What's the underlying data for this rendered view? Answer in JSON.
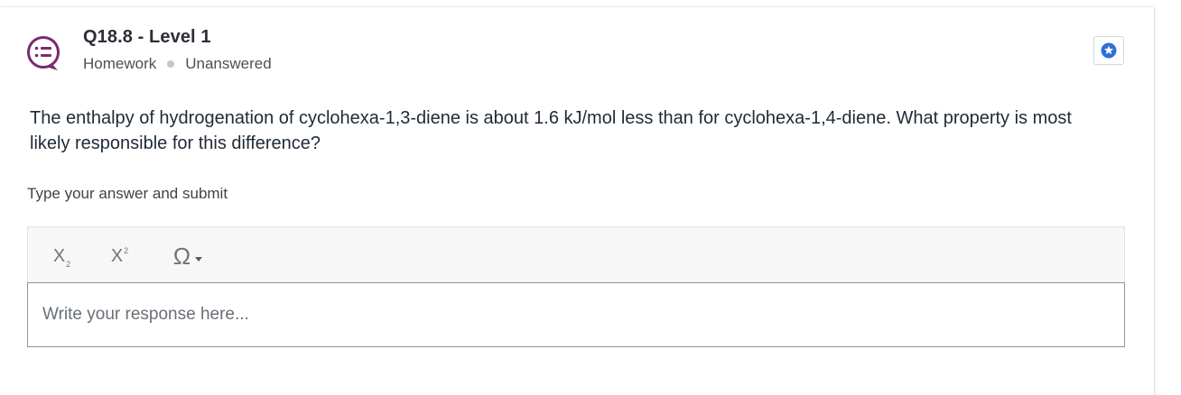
{
  "header": {
    "title": "Q18.8 - Level 1",
    "category": "Homework",
    "status": "Unanswered"
  },
  "icons": {
    "question_icon": "speech-bubble-list-icon",
    "star_icon": "star-badge-icon"
  },
  "colors": {
    "question_icon_accent": "#7a2a6e",
    "star_accent": "#2f6fd6"
  },
  "question": {
    "text": "The enthalpy of hydrogenation of cyclohexa-1,3-diene is about 1.6 kJ/mol less than for cyclohexa-1,4-diene. What property is most likely responsible for this difference?"
  },
  "answer": {
    "prompt": "Type your answer and submit",
    "toolbar": {
      "subscript_label": "X",
      "subscript_mark": "2",
      "superscript_label": "X",
      "superscript_mark": "2",
      "special_chars_label": "Ω"
    },
    "response_value": "",
    "response_placeholder": "Write your response here..."
  }
}
